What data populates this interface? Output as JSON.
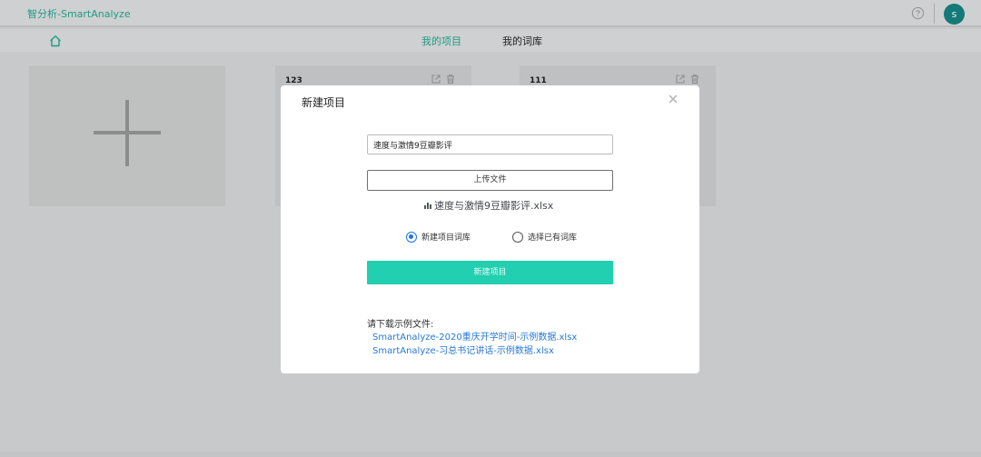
{
  "header": {
    "brand": "智分析-SmartAnalyze",
    "avatar_letter": "s"
  },
  "nav": {
    "tabs": [
      {
        "label": "我的项目",
        "active": true
      },
      {
        "label": "我的词库",
        "active": false
      }
    ]
  },
  "projects": [
    {
      "title": "123"
    },
    {
      "title": "111"
    }
  ],
  "modal": {
    "title": "新建项目",
    "name_input_value": "速度与激情9豆瓣影评",
    "upload_label": "上传文件",
    "uploaded_file": "速度与激情9豆瓣影评.xlsx",
    "radios": [
      {
        "label": "新建项目词库",
        "checked": true
      },
      {
        "label": "选择已有词库",
        "checked": false
      }
    ],
    "create_label": "新建项目",
    "download_title": "请下载示例文件:",
    "download_links": [
      "SmartAnalyze-2020重庆开学时间-示例数据.xlsx",
      "SmartAnalyze-习总书记讲话-示例数据.xlsx"
    ]
  },
  "colors": {
    "brand": "#1e9c86",
    "accent": "#22cfb0",
    "link": "#2878d6",
    "avatar": "#137a78"
  }
}
